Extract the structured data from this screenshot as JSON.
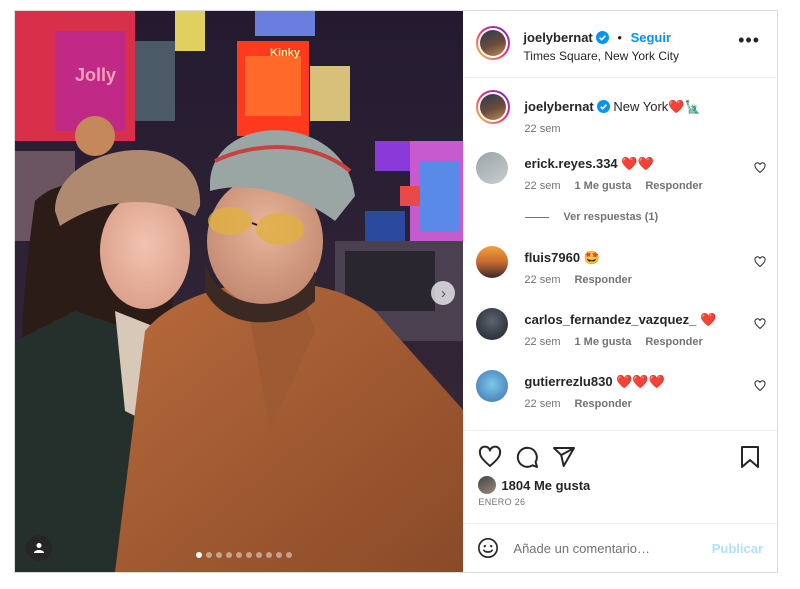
{
  "post": {
    "author": "joelybernat",
    "follow_label": "Seguir",
    "location": "Times Square, New York City",
    "more_label": "•••",
    "photo_signs": [
      "Jolly",
      "Kinky"
    ],
    "carousel": {
      "count": 10,
      "active_index": 0
    }
  },
  "caption": {
    "username": "joelybernat",
    "text": "New York",
    "emoji": "❤️🗽",
    "time": "22 sem"
  },
  "comments": [
    {
      "username": "erick.reyes.334",
      "text": "❤️❤️",
      "time": "22 sem",
      "likes": "1 Me gusta",
      "reply": "Responder",
      "avatar_colors": [
        "#9aa4a8",
        "#c7cdd0"
      ]
    },
    {
      "username": "fluis7960",
      "text": "🤩",
      "time": "22 sem",
      "likes": "",
      "reply": "Responder",
      "avatar_colors": [
        "#f2a23a",
        "#3a2a2a"
      ]
    },
    {
      "username": "carlos_fernandez_vazquez_",
      "text": "❤️",
      "time": "22 sem",
      "likes": "1 Me gusta",
      "reply": "Responder",
      "avatar_colors": [
        "#5b6470",
        "#1e2228"
      ]
    },
    {
      "username": "gutierrezlu830",
      "text": "❤️❤️❤️",
      "time": "22 sem",
      "likes": "",
      "reply": "Responder",
      "avatar_colors": [
        "#7ec8e8",
        "#3a6fb0"
      ]
    }
  ],
  "replies_label": "Ver respuestas (1)",
  "engagement": {
    "likes": "1804 Me gusta",
    "date": "ENERO 26"
  },
  "composer": {
    "placeholder": "Añade un comentario…",
    "publish_label": "Publicar"
  },
  "colors": {
    "accent": "#0095f6",
    "publish_disabled": "#b2dffc",
    "heart_red": "#ed4956",
    "muted_text": "#737373"
  }
}
